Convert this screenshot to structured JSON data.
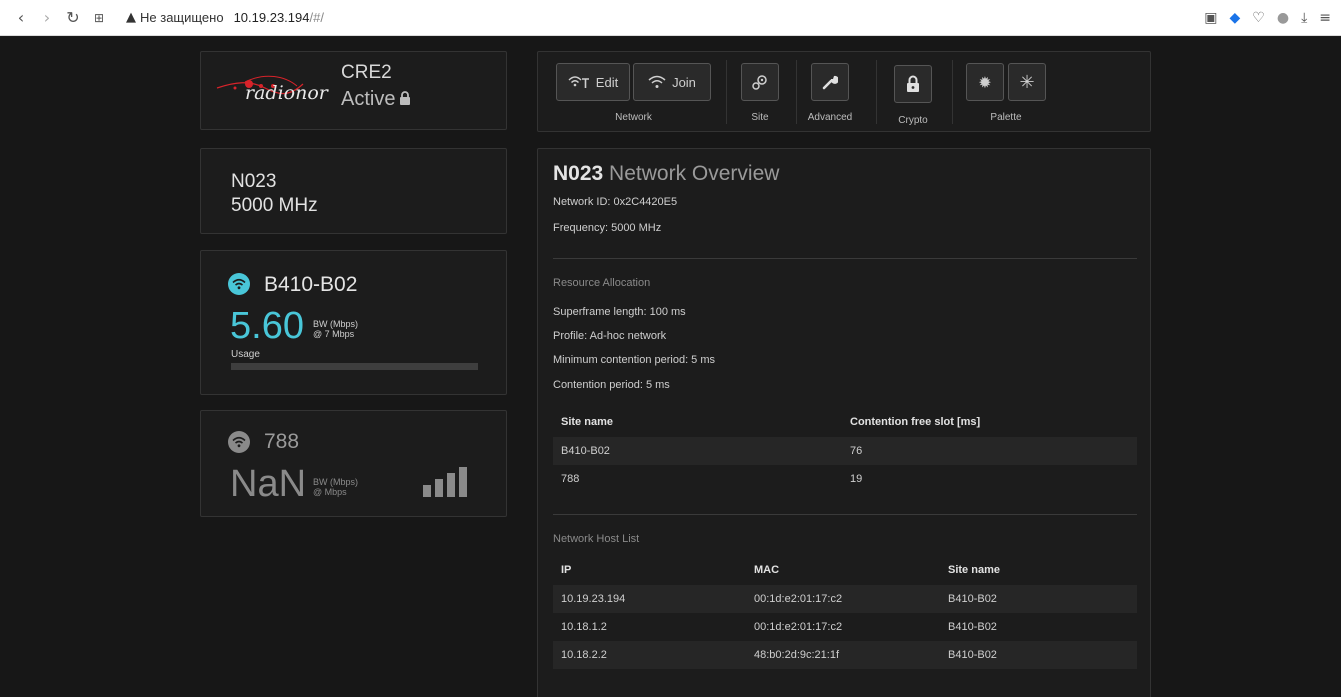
{
  "browser": {
    "back_icon": "back-arrow-icon",
    "forward_icon": "forward-arrow-icon",
    "reload_icon": "reload-icon",
    "tabs_icon": "tab-grid-icon",
    "security_label": "Не защищено",
    "url_host": "10.19.23.194",
    "url_path": "/#/"
  },
  "device": {
    "logo_text": "radionor",
    "name": "CRE2",
    "status": "Active"
  },
  "toolbar": {
    "edit_label": "Edit",
    "join_label": "Join",
    "network_label": "Network",
    "site_label": "Site",
    "advanced_label": "Advanced",
    "crypto_label": "Crypto",
    "palette_label": "Palette"
  },
  "network": {
    "id": "N023",
    "frequency": "5000 MHz"
  },
  "sites": [
    {
      "name": "B410-B02",
      "bw_value": "5.60",
      "bw_unit": "BW (Mbps)",
      "bw_rate": "@ 7 Mbps",
      "usage_label": "Usage",
      "usage_fraction": 0,
      "accent": "#49c6d8"
    },
    {
      "name": "788",
      "bw_value": "NaN",
      "bw_unit": "BW (Mbps)",
      "bw_rate": "@ Mbps",
      "signal_level": 4,
      "accent": "#8a8a8a"
    }
  ],
  "overview": {
    "title_id": "N023",
    "title_suffix": "Network Overview",
    "network_id": "Network ID: 0x2C4420E5",
    "frequency": "Frequency: 5000 MHz",
    "resource_heading": "Resource Allocation",
    "superframe": "Superframe length: 100 ms",
    "profile": "Profile: Ad-hoc network",
    "min_contention": "Minimum contention period: 5 ms",
    "contention": "Contention period: 5 ms",
    "slot_table": {
      "headers": [
        "Site name",
        "Contention free slot [ms]"
      ],
      "rows": [
        [
          "B410-B02",
          "76"
        ],
        [
          "788",
          "19"
        ]
      ]
    },
    "host_heading": "Network Host List",
    "host_table": {
      "headers": [
        "IP",
        "MAC",
        "Site name"
      ],
      "rows": [
        [
          "10.19.23.194",
          "00:1d:e2:01:17:c2",
          "B410-B02"
        ],
        [
          "10.18.1.2",
          "00:1d:e2:01:17:c2",
          "B410-B02"
        ],
        [
          "10.18.2.2",
          "48:b0:2d:9c:21:1f",
          "B410-B02"
        ]
      ]
    }
  },
  "colors": {
    "background": "#171717",
    "panel": "#1c1c1c",
    "accent": "#49c6d8",
    "logo_red": "#d8232a"
  }
}
